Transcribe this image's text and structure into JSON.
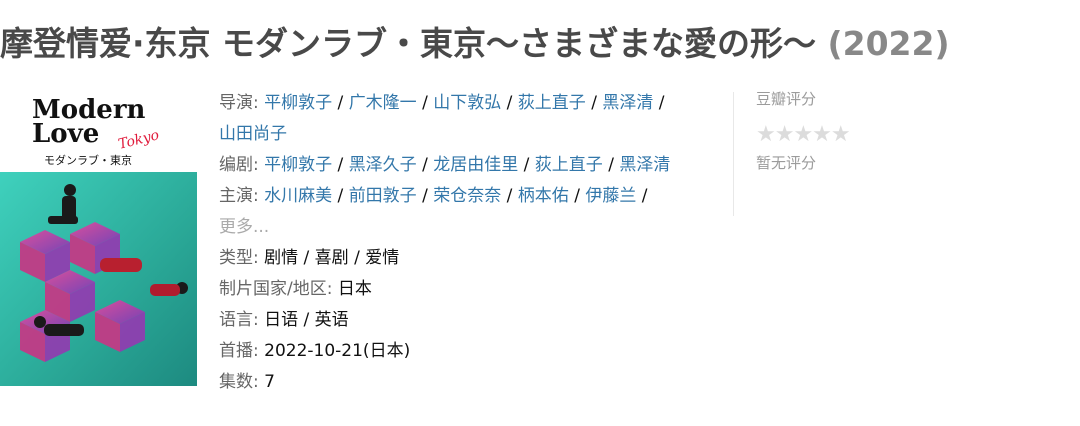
{
  "title": {
    "main": "摩登情爱·东京 モダンラブ・東京～さまざまな愛の形～",
    "year": "(2022)"
  },
  "poster": {
    "logo_line1": "Modern",
    "logo_line2": "Love",
    "logo_script": "Tokyo",
    "subtitle": "モダンラブ・東京"
  },
  "info": {
    "director_label": "导演:",
    "directors": [
      "平柳敦子",
      "广木隆一",
      "山下敦弘",
      "荻上直子",
      "黑泽清",
      "山田尚子"
    ],
    "writer_label": "编剧:",
    "writers": [
      "平柳敦子",
      "黑泽久子",
      "龙居由佳里",
      "荻上直子",
      "黑泽清"
    ],
    "cast_label": "主演:",
    "cast": [
      "水川麻美",
      "前田敦子",
      "荣仓奈奈",
      "柄本佑",
      "伊藤兰"
    ],
    "more_link": "更多...",
    "genre_label": "类型:",
    "genre": "剧情 / 喜剧 / 爱情",
    "country_label": "制片国家/地区:",
    "country": "日本",
    "language_label": "语言:",
    "language": "日语 / 英语",
    "premiere_label": "首播:",
    "premiere": "2022-10-21(日本)",
    "episodes_label": "集数:",
    "episodes": "7"
  },
  "rating": {
    "label": "豆瓣评分",
    "stars": "★★★★★",
    "stars_filled": 0,
    "no_rating": "暂无评分"
  }
}
